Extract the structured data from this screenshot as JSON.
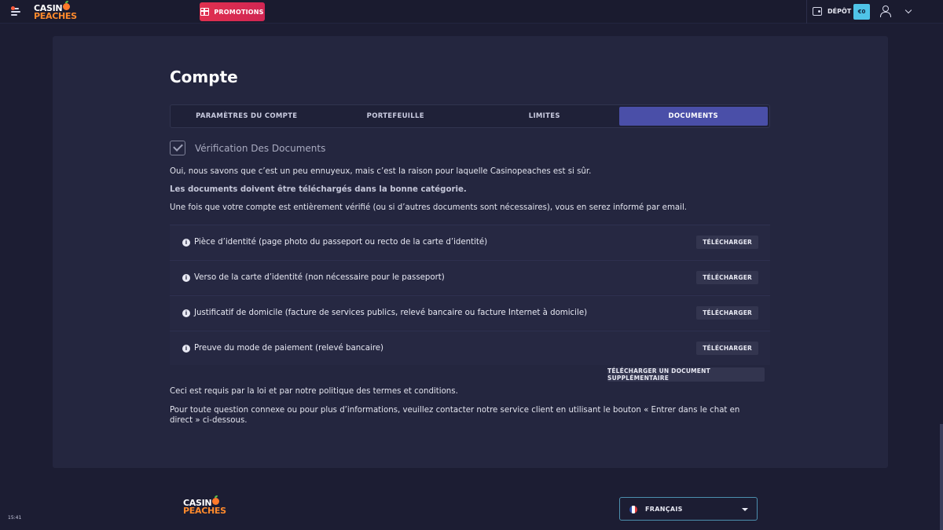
{
  "header": {
    "logo_top": "CASIN",
    "logo_bottom": "PEACHES",
    "promotions_label": "PROMOTIONS",
    "deposit_label": "DÉPÔT",
    "balance": "€0"
  },
  "page": {
    "title": "Compte",
    "tabs": [
      {
        "label": "PARAMÈTRES DU COMPTE",
        "active": false
      },
      {
        "label": "PORTEFEUILLE",
        "active": false
      },
      {
        "label": "LIMITES",
        "active": false
      },
      {
        "label": "DOCUMENTS",
        "active": true
      }
    ],
    "verification_title": "Vérification Des Documents",
    "intro_1": "Oui, nous savons que c’est un peu ennuyeux, mais c’est la raison pour laquelle Casinopeaches est si sûr.",
    "intro_2": "Les documents doivent être téléchargés dans la bonne catégorie.",
    "intro_3": "Une fois que votre compte est entièrement vérifié (ou si d’autres documents sont nécessaires), vous en serez informé par email.",
    "documents": [
      {
        "label": "Pièce d’identité (page photo du passeport ou recto de la carte d’identité)",
        "button": "TÉLÉCHARGER"
      },
      {
        "label": "Verso de la carte d’identité (non nécessaire pour le passeport)",
        "button": "TÉLÉCHARGER"
      },
      {
        "label": "Justificatif de domicile (facture de services publics, relevé bancaire ou facture Internet à domicile)",
        "button": "TÉLÉCHARGER"
      },
      {
        "label": "Preuve du mode de paiement (relevé bancaire)",
        "button": "TÉLÉCHARGER"
      }
    ],
    "extra_upload_label": "TÉLÉCHARGER UN DOCUMENT SUPPLÉMENTAIRE",
    "legal_note": "Ceci est requis par la loi et par notre politique des termes et conditions.",
    "contact_note": "Pour toute question connexe ou pour plus d’informations, veuillez contacter notre service client en utilisant le bouton « Entrer dans le chat en direct » ci-dessous."
  },
  "footer": {
    "logo_top": "CASIN",
    "logo_bottom": "PEACHES",
    "language": "FRANÇAIS",
    "clock": "15:41"
  },
  "colors": {
    "background": "#1c1d33",
    "panel": "#24263f",
    "active_tab": "#4a4fa8",
    "promo": "#e0304f",
    "balance_chip": "#4fc4e8",
    "logo_accent": "#ff8a2c"
  },
  "icons": [
    "menu-icon",
    "gift-icon",
    "wallet-icon",
    "user-icon",
    "chevron-down-icon",
    "checkbox-icon",
    "info-icon",
    "flag-icon",
    "caret-down-icon"
  ]
}
